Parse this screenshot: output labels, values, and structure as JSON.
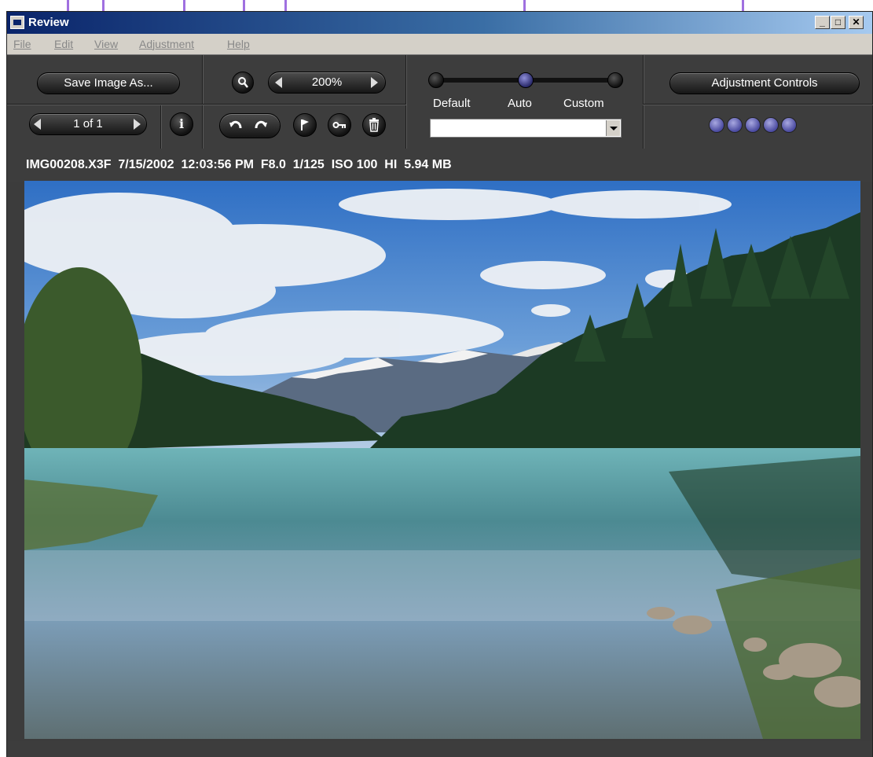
{
  "window": {
    "title": "Review"
  },
  "menu": {
    "items": [
      "File",
      "Edit",
      "View",
      "Adjustment",
      "Help"
    ]
  },
  "window_buttons": {
    "minimize": "_",
    "maximize": "□",
    "close": "✕"
  },
  "toolbar": {
    "save_label": "Save Image As...",
    "page_label": "1 of 1",
    "zoom_label": "200%",
    "adjustment_label": "Adjustment Controls",
    "slider": {
      "left": "Default",
      "middle": "Auto",
      "right": "Custom",
      "value": "Auto"
    },
    "preset_dropdown_value": "",
    "info_icon": "i"
  },
  "info": {
    "filename": "IMG00208.X3F",
    "date": "7/15/2002",
    "time": "12:03:56 PM",
    "aperture": "F8.0",
    "shutter": "1/125",
    "iso": "ISO 100",
    "quality": "HI",
    "size": "5.94 MB"
  },
  "icons": {
    "zoom": "magnifier-icon",
    "info": "info-icon",
    "rotate_left": "rotate-left-icon",
    "rotate_right": "rotate-right-icon",
    "flag": "flag-icon",
    "key": "key-icon",
    "trash": "trash-icon"
  },
  "colors": {
    "callout": "#a070e0",
    "dots": "#6a6ac8",
    "panel": "#3d3d3d"
  }
}
